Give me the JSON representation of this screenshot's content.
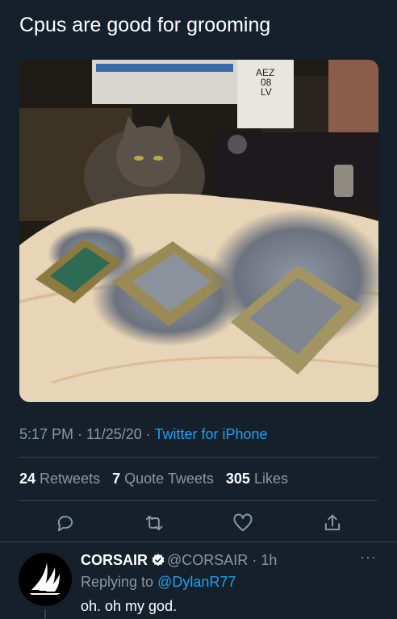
{
  "tweet": {
    "text": "Cpus are good for grooming",
    "time": "5:17 PM",
    "sep1": " · ",
    "date": "11/25/20",
    "sep2": " · ",
    "source": "Twitter for iPhone",
    "photo_box_text": [
      "AEZ",
      "08",
      "LV"
    ]
  },
  "stats": {
    "retweets_count": "24",
    "retweets_label": "Retweets",
    "quotes_count": "7",
    "quotes_label": "Quote Tweets",
    "likes_count": "305",
    "likes_label": "Likes"
  },
  "actions": [
    "reply-icon",
    "retweet-icon",
    "like-icon",
    "share-icon"
  ],
  "reply": {
    "name": "CORSAIR",
    "handle": "@CORSAIR",
    "sep": " · ",
    "time": "1h",
    "replying_label": "Replying to",
    "replying_handle": "@DylanR77",
    "text": "oh. oh my god.",
    "more": "···"
  },
  "colors": {
    "background": "#15202b",
    "secondary_text": "#8899a6",
    "link": "#1da1f2",
    "divider": "#38444d",
    "verified": "#ffffff"
  }
}
